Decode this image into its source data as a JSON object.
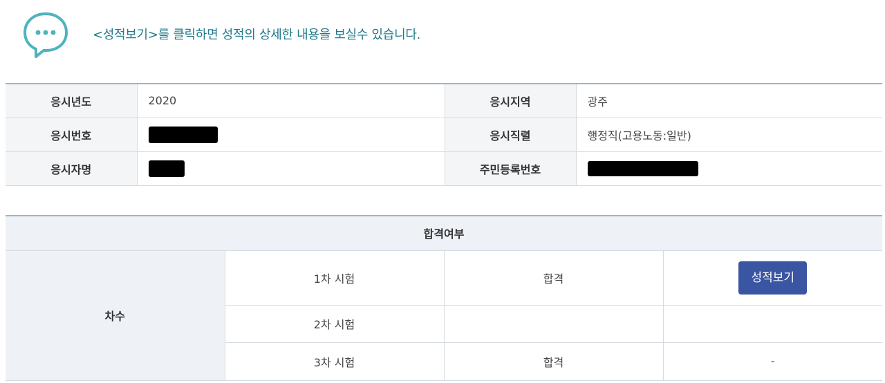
{
  "notice": {
    "icon": "speech-bubble-icon",
    "text": "<성적보기>를 클릭하면 성적의 상세한 내용을 보실수 있습니다."
  },
  "info": {
    "year_label": "응시년도",
    "year_value": "2020",
    "region_label": "응시지역",
    "region_value": "광주",
    "number_label": "응시번호",
    "job_label": "응시직렬",
    "job_value": "행정직(고용노동:일반)",
    "name_label": "응시자명",
    "id_label": "주민등록번호"
  },
  "result": {
    "header": "합격여부",
    "chasu_label": "차수",
    "rows": [
      {
        "round": "1차 시험",
        "status": "합격",
        "action": "성적보기"
      },
      {
        "round": "2차 시험",
        "status": "",
        "action": ""
      },
      {
        "round": "3차 시험",
        "status": "합격",
        "action": "-"
      }
    ]
  },
  "colors": {
    "accent": "#1f7a8c",
    "button": "#3a55a2",
    "border_top": "#9db4cc"
  }
}
